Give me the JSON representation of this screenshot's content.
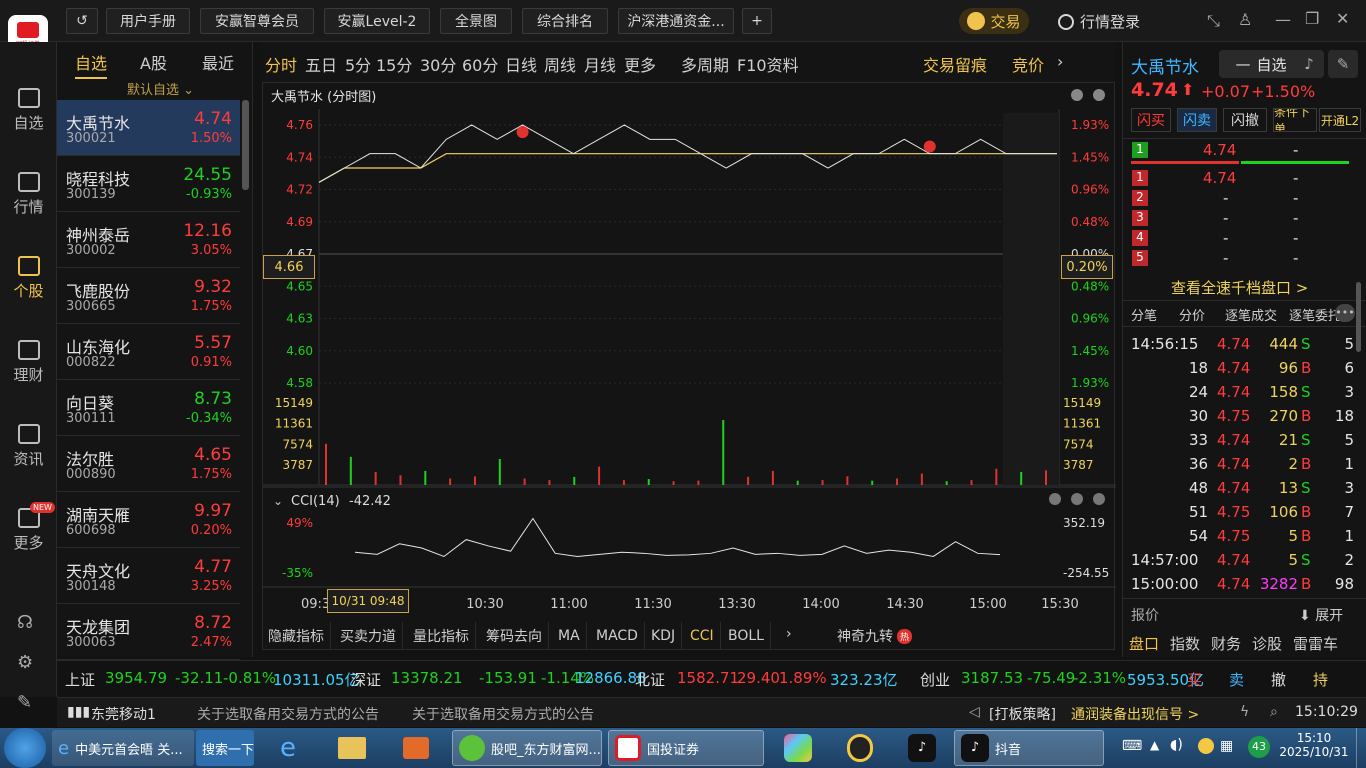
{
  "toolbar": {
    "buttons": [
      "用户手册",
      "安赢智尊会员",
      "安赢Level-2",
      "全景图",
      "综合排名",
      "沪深港通资金..."
    ],
    "trade": "交易",
    "login": "行情登录",
    "logo_text": "国投证券"
  },
  "leftnav": [
    "自选",
    "行情",
    "个股",
    "理财",
    "资讯",
    "更多"
  ],
  "leftnav_badge": "NEW",
  "watchlist": {
    "tabs": [
      "自选",
      "A股",
      "最近"
    ],
    "group": "默认自选",
    "rows": [
      {
        "name": "大禹节水",
        "code": "300021",
        "price": "4.74",
        "pct": "1.50%",
        "dir": "up"
      },
      {
        "name": "晓程科技",
        "code": "300139",
        "price": "24.55",
        "pct": "-0.93%",
        "dir": "down"
      },
      {
        "name": "神州泰岳",
        "code": "300002",
        "price": "12.16",
        "pct": "3.05%",
        "dir": "up"
      },
      {
        "name": "飞鹿股份",
        "code": "300665",
        "price": "9.32",
        "pct": "1.75%",
        "dir": "up"
      },
      {
        "name": "山东海化",
        "code": "000822",
        "price": "5.57",
        "pct": "0.91%",
        "dir": "up"
      },
      {
        "name": "向日葵",
        "code": "300111",
        "price": "8.73",
        "pct": "-0.34%",
        "dir": "down"
      },
      {
        "name": "法尔胜",
        "code": "000890",
        "price": "4.65",
        "pct": "1.75%",
        "dir": "up"
      },
      {
        "name": "湖南天雁",
        "code": "600698",
        "price": "9.97",
        "pct": "0.20%",
        "dir": "up"
      },
      {
        "name": "天舟文化",
        "code": "300148",
        "price": "4.77",
        "pct": "3.25%",
        "dir": "up"
      },
      {
        "name": "天龙集团",
        "code": "300063",
        "price": "8.72",
        "pct": "2.47%",
        "dir": "up"
      }
    ]
  },
  "periods": [
    "分时",
    "五日",
    "5分",
    "15分",
    "30分",
    "60分",
    "日线",
    "周线",
    "月线",
    "更多",
    "多周期",
    "F10资料"
  ],
  "period_right": [
    "交易留痕",
    "竞价"
  ],
  "chart": {
    "title": "大禹节水 (分时图)",
    "left_price_ticks": [
      "4.76",
      "4.74",
      "4.72",
      "4.69",
      "4.67",
      "4.65",
      "4.63",
      "4.60",
      "4.58"
    ],
    "right_pct_ticks": [
      "1.93%",
      "1.45%",
      "0.96%",
      "0.48%",
      "0.00%",
      "0.48%",
      "0.96%",
      "1.45%",
      "1.93%"
    ],
    "cursor_price": "4.66",
    "cursor_pct": "0.20%",
    "volume_ticks": [
      "15149",
      "11361",
      "7574",
      "3787"
    ],
    "cci_label": "CCI(14)",
    "cci_value": "-42.42",
    "cci_left_ticks": [
      "49%",
      "-35%"
    ],
    "cci_right_ticks": [
      "352.19",
      "-254.55"
    ],
    "time_ticks": [
      "09:3",
      "10:30",
      "11:00",
      "11:30",
      "13:30",
      "14:00",
      "14:30",
      "15:00",
      "15:30"
    ],
    "cursor_time": "10/31 09:48",
    "indicator_tabs": [
      "隐藏指标",
      "买卖力道",
      "量比指标",
      "筹码去向",
      "MA",
      "MACD",
      "KDJ",
      "CCI",
      "BOLL"
    ],
    "special_tab": "神奇九转",
    "special_badge": "热"
  },
  "chart_data": [
    {
      "type": "line",
      "title": "大禹节水 (分时图)",
      "series": [
        {
          "values": [
            4.72,
            4.73,
            4.74,
            4.74,
            4.73,
            4.75,
            4.76,
            4.75,
            4.76,
            4.75,
            4.74,
            4.75,
            4.76,
            4.75,
            4.75,
            4.74,
            4.73,
            4.74,
            4.74,
            4.74,
            4.73,
            4.74,
            4.74,
            4.75,
            4.74,
            4.74,
            4.75,
            4.74,
            4.74,
            4.74
          ]
        },
        {
          "values": [
            4.72,
            4.73,
            4.73,
            4.73,
            4.73,
            4.74,
            4.74,
            4.74,
            4.74,
            4.74,
            4.74,
            4.74,
            4.74,
            4.74,
            4.74,
            4.74,
            4.74,
            4.74,
            4.74,
            4.74,
            4.74,
            4.74,
            4.74,
            4.74,
            4.74,
            4.74,
            4.74,
            4.74,
            4.74,
            4.74
          ]
        }
      ],
      "ylim": [
        4.58,
        4.76
      ]
    },
    {
      "type": "bar",
      "values": [
        7600,
        5200,
        2400,
        1800,
        2600,
        1200,
        1600,
        4800,
        1200,
        900,
        1500,
        3400,
        900,
        1100,
        700,
        800,
        12000,
        1500,
        2600,
        800,
        900,
        1600,
        800,
        1200,
        2100,
        700,
        900,
        3000,
        2400,
        2700
      ],
      "ylim": [
        0,
        15149
      ]
    },
    {
      "type": "line",
      "values": [
        -20,
        -40,
        60,
        20,
        -60,
        100,
        40,
        -10,
        300,
        -30,
        -60,
        -40,
        -20,
        -30,
        -50,
        -45,
        -30,
        20,
        -40,
        -30,
        -50,
        -40,
        40,
        -30,
        0,
        -20,
        -60,
        80,
        -30,
        -42
      ],
      "ylim": [
        -254.55,
        352.19
      ]
    }
  ],
  "stock": {
    "name": "大禹节水",
    "price": "4.74",
    "change": "+0.07",
    "pct": "+1.50%",
    "watch_btn": "自选",
    "actions": [
      "闪买",
      "闪卖",
      "闪撤",
      "条件下单",
      "开通L2"
    ]
  },
  "orderbook": {
    "buy1": {
      "lvl": "1",
      "price": "4.74",
      "vol": "-"
    },
    "sells": [
      {
        "lvl": "1",
        "price": "4.74",
        "vol": "-"
      },
      {
        "lvl": "2",
        "price": "-",
        "vol": "-"
      },
      {
        "lvl": "3",
        "price": "-",
        "vol": "-"
      },
      {
        "lvl": "4",
        "price": "-",
        "vol": "-"
      },
      {
        "lvl": "5",
        "price": "-",
        "vol": "-"
      }
    ],
    "more": "查看全速千档盘口 >"
  },
  "ticks_tabs": [
    "分笔",
    "分价",
    "逐笔成交",
    "逐笔委托"
  ],
  "ticks": [
    {
      "t": "14:56:15",
      "p": "4.74",
      "v": "444",
      "s": "S",
      "n": "5"
    },
    {
      "t": "18",
      "p": "4.74",
      "v": "96",
      "s": "B",
      "n": "6"
    },
    {
      "t": "24",
      "p": "4.74",
      "v": "158",
      "s": "S",
      "n": "3"
    },
    {
      "t": "30",
      "p": "4.75",
      "v": "270",
      "s": "B",
      "n": "18"
    },
    {
      "t": "33",
      "p": "4.74",
      "v": "21",
      "s": "S",
      "n": "5"
    },
    {
      "t": "36",
      "p": "4.74",
      "v": "2",
      "s": "B",
      "n": "1"
    },
    {
      "t": "48",
      "p": "4.74",
      "v": "13",
      "s": "S",
      "n": "3"
    },
    {
      "t": "51",
      "p": "4.75",
      "v": "106",
      "s": "B",
      "n": "7"
    },
    {
      "t": "54",
      "p": "4.75",
      "v": "5",
      "s": "B",
      "n": "1"
    },
    {
      "t": "14:57:00",
      "p": "4.74",
      "v": "5",
      "s": "S",
      "n": "2"
    },
    {
      "t": "15:00:00",
      "p": "4.74",
      "v": "3282",
      "s": "B",
      "n": "98"
    }
  ],
  "report": {
    "label": "报价",
    "expand": "展开"
  },
  "bottom_tabs": [
    "盘口",
    "指数",
    "财务",
    "诊股",
    "雷雷车"
  ],
  "indices": [
    {
      "name": "上证",
      "val": "3954.79",
      "chg": "-32.11",
      "pct": "-0.81%",
      "amt": "10311.05亿"
    },
    {
      "name": "深证",
      "val": "13378.21",
      "chg": "-153.91",
      "pct": "-1.14%",
      "amt": "12866.88"
    },
    {
      "name": "北证",
      "val": "1582.71",
      "chg": "29.40",
      "pct": "1.89%",
      "amt": "323.23亿"
    },
    {
      "name": "创业",
      "val": "3187.53",
      "chg": "-75.49",
      "pct": "-2.31%",
      "amt": "5953.50亿"
    }
  ],
  "quick": [
    "买",
    "卖",
    "撤",
    "持"
  ],
  "status": {
    "network": "东莞移动1",
    "notice1": "关于选取备用交易方式的公告",
    "notice2": "关于选取备用交易方式的公告",
    "news_tag": "[打板策略]",
    "news_text": "通润装备出现信号 >",
    "time": "15:10:29"
  },
  "taskbar": {
    "items": [
      "中美元首会晤 关...",
      "搜索一下",
      "股吧_东方财富网...",
      "国投证券",
      "抖音"
    ],
    "clock_time": "15:10",
    "clock_date": "2025/10/31",
    "badge": "43"
  }
}
